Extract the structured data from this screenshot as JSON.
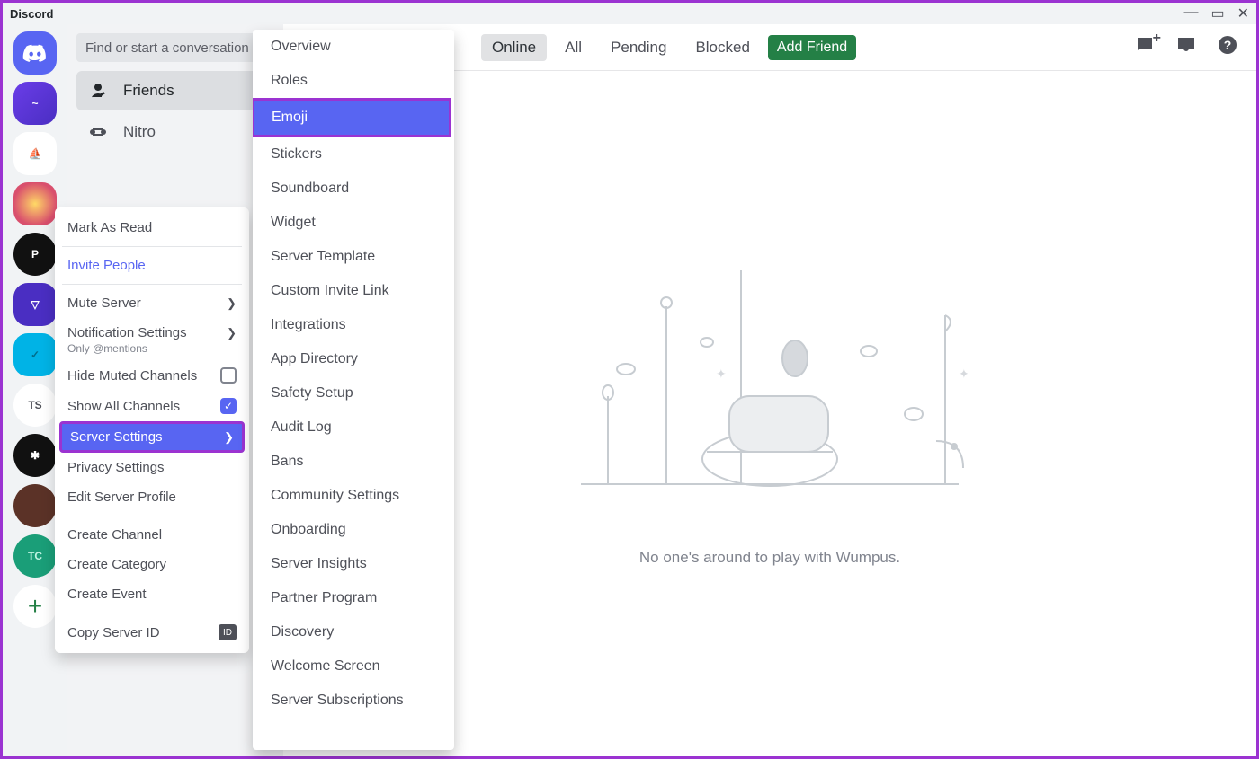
{
  "titlebar": {
    "brand": "Discord"
  },
  "servers": {
    "home": "⌂",
    "icons": [
      {
        "cls": "wave",
        "text": "~"
      },
      {
        "cls": "sail",
        "text": "⛵"
      },
      {
        "cls": "g1",
        "text": ""
      },
      {
        "cls": "g2",
        "text": "P"
      },
      {
        "cls": "g3",
        "text": "▽"
      },
      {
        "cls": "g4",
        "text": "✓"
      },
      {
        "cls": "g5",
        "text": "TS"
      },
      {
        "cls": "g6",
        "text": "✱"
      },
      {
        "cls": "g7",
        "text": ""
      },
      {
        "cls": "g8",
        "text": "TC"
      }
    ],
    "add": "+"
  },
  "second_col": {
    "search_placeholder": "Find or start a conversation",
    "nav": [
      {
        "label": "Friends",
        "active": true
      },
      {
        "label": "Nitro",
        "active": false
      }
    ]
  },
  "context_menu": {
    "mark_read": "Mark As Read",
    "invite": "Invite People",
    "mute": "Mute Server",
    "notif": "Notification Settings",
    "notif_sub": "Only @mentions",
    "hide_muted": "Hide Muted Channels",
    "show_all": "Show All Channels",
    "server_settings": "Server Settings",
    "privacy": "Privacy Settings",
    "edit_profile": "Edit Server Profile",
    "create_channel": "Create Channel",
    "create_category": "Create Category",
    "create_event": "Create Event",
    "copy_id": "Copy Server ID",
    "id_badge": "ID"
  },
  "submenu": {
    "items": [
      "Overview",
      "Roles",
      "Emoji",
      "Stickers",
      "Soundboard",
      "Widget",
      "Server Template",
      "Custom Invite Link",
      "Integrations",
      "App Directory",
      "Safety Setup",
      "Audit Log",
      "Bans",
      "Community Settings",
      "Onboarding",
      "Server Insights",
      "Partner Program",
      "Discovery",
      "Welcome Screen",
      "Server Subscriptions"
    ],
    "highlight_index": 2
  },
  "topbar": {
    "tabs": [
      "Online",
      "All",
      "Pending",
      "Blocked"
    ],
    "active_tab_index": 0,
    "add_friend": "Add Friend"
  },
  "content": {
    "empty_text": "No one's around to play with Wumpus."
  }
}
